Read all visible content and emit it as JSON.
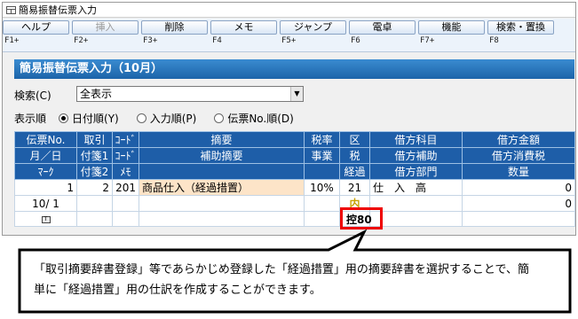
{
  "window": {
    "title": "簡易振替伝票入力"
  },
  "toolbar": [
    {
      "label": "ヘルプ",
      "key": "F1+",
      "enabled": true
    },
    {
      "label": "挿入",
      "key": "F2+",
      "enabled": false
    },
    {
      "label": "削除",
      "key": "F3+",
      "enabled": true
    },
    {
      "label": "メモ",
      "key": "F4",
      "enabled": true
    },
    {
      "label": "ジャンプ",
      "key": "F5+",
      "enabled": true
    },
    {
      "label": "電卓",
      "key": "F6",
      "enabled": true
    },
    {
      "label": "機能",
      "key": "F7+",
      "enabled": true
    },
    {
      "label": "検索・置換",
      "key": "F8",
      "enabled": true
    }
  ],
  "header": {
    "title": "簡易振替伝票入力（10月）"
  },
  "search": {
    "label": "検索(C)",
    "value": "全表示"
  },
  "order": {
    "label": "表示順",
    "options": [
      {
        "label": "日付順(Y)",
        "selected": true
      },
      {
        "label": "入力順(P)",
        "selected": false
      },
      {
        "label": "伝票No.順(D)",
        "selected": false
      }
    ]
  },
  "grid": {
    "header_rows": [
      [
        "伝票No.",
        "取引",
        "ｺｰﾄﾞ",
        "摘要",
        "税率",
        "区",
        "借方科目",
        "借方金額"
      ],
      [
        "月／日",
        "付箋1",
        "ｺｰﾄﾞ",
        "補助摘要",
        "事業",
        "税",
        "借方補助",
        "借方消費税"
      ],
      [
        "ﾏｰｸ",
        "付箋2",
        "ﾒﾓ",
        "",
        "",
        "経過",
        "借方部門",
        "数量"
      ]
    ],
    "rows": [
      [
        "1",
        "2",
        "201",
        "商品仕入（経過措置）",
        "10%",
        "21",
        "仕　入　高",
        "0"
      ],
      [
        "10/ 1",
        "",
        "",
        "",
        "",
        "内",
        "",
        "0"
      ],
      [
        "",
        "",
        "",
        "",
        "",
        "",
        "",
        ""
      ]
    ]
  },
  "highlight": {
    "text": "控80"
  },
  "callout": {
    "line1": "「取引摘要辞書登録」等であらかじめ登録した「経過措置」用の摘要辞書を選択することで、簡",
    "line2": "単に「経過措置」用の仕訳を作成することができます。"
  }
}
